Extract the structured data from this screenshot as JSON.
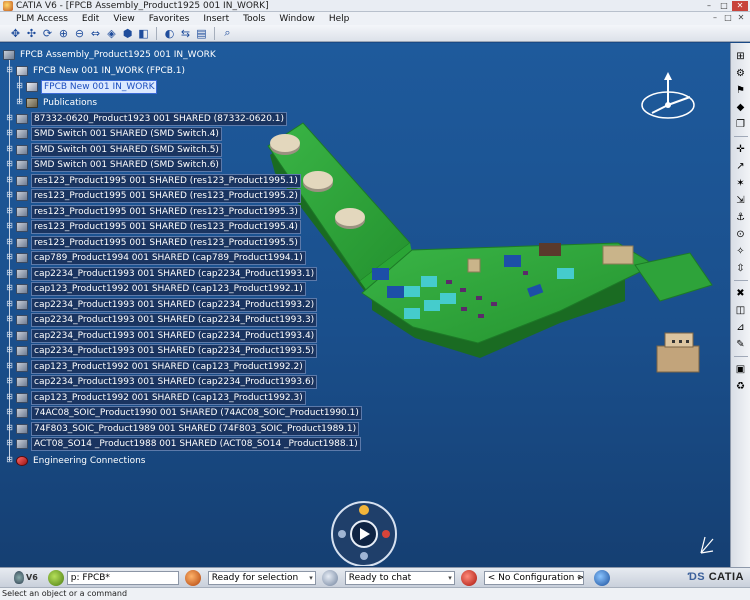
{
  "window": {
    "title": "CATIA V6 - [FPCB Assembly_Product1925 001 IN_WORK]",
    "minimize_glyph": "–",
    "maximize_glyph": "□",
    "close_glyph": "✕"
  },
  "menu": {
    "items": [
      "PLM Access",
      "Edit",
      "View",
      "Favorites",
      "Insert",
      "Tools",
      "Window",
      "Help"
    ],
    "right_icons": [
      "–",
      "□",
      "✕"
    ]
  },
  "toolbar": {
    "icons": [
      "select-icon",
      "pan-icon",
      "rotate-icon",
      "zoom-in-icon",
      "zoom-out-icon",
      "normal-view-icon",
      "fit-all-icon",
      "isometric-view-icon",
      "shading-icon",
      "hide-show-icon",
      "swap-visible-icon",
      "properties-icon",
      "search-icon"
    ]
  },
  "tree": {
    "root": "FPCB Assembly_Product1925 001 IN_WORK",
    "fpcb": "FPCB New 001 IN_WORK (FPCB.1)",
    "fpcb_selected": "FPCB New 001 IN_WORK",
    "publications": "Publications",
    "items": [
      "87332-0620_Product1923 001 SHARED (87332-0620.1)",
      "SMD Switch 001 SHARED (SMD Switch.4)",
      "SMD Switch 001 SHARED (SMD Switch.5)",
      "SMD Switch 001 SHARED (SMD Switch.6)",
      "res123_Product1995 001 SHARED (res123_Product1995.1)",
      "res123_Product1995 001 SHARED (res123_Product1995.2)",
      "res123_Product1995 001 SHARED (res123_Product1995.3)",
      "res123_Product1995 001 SHARED (res123_Product1995.4)",
      "res123_Product1995 001 SHARED (res123_Product1995.5)",
      "cap789_Product1994 001 SHARED (cap789_Product1994.1)",
      "cap2234_Product1993 001 SHARED (cap2234_Product1993.1)",
      "cap123_Product1992 001 SHARED (cap123_Product1992.1)",
      "cap2234_Product1993 001 SHARED (cap2234_Product1993.2)",
      "cap2234_Product1993 001 SHARED (cap2234_Product1993.3)",
      "cap2234_Product1993 001 SHARED (cap2234_Product1993.4)",
      "cap2234_Product1993 001 SHARED (cap2234_Product1993.5)",
      "cap123_Product1992 001 SHARED (cap123_Product1992.2)",
      "cap2234_Product1993 001 SHARED (cap2234_Product1993.6)",
      "cap123_Product1992 001 SHARED (cap123_Product1992.3)",
      "74AC08_SOIC_Product1990 001 SHARED (74AC08_SOIC_Product1990.1)",
      "74F803_SOIC_Product1989 001 SHARED (74F803_SOIC_Product1989.1)",
      "ACT08_SO14 _Product1988 001 SHARED (ACT08_SO14 _Product1988.1)"
    ],
    "engineering": "Engineering Connections"
  },
  "taskbar": {
    "v6_label": "V6",
    "search_value": "p: FPCB*",
    "status_select": "Ready for selection",
    "chat_status": "Ready to chat",
    "configuration": "< No Configuration >",
    "brand": "CATIA"
  },
  "statusbar": {
    "prompt": "Select an object or a command"
  },
  "colors": {
    "background": "#1a4a86",
    "board": "#2ea33a",
    "selection": "#dce9ff"
  }
}
